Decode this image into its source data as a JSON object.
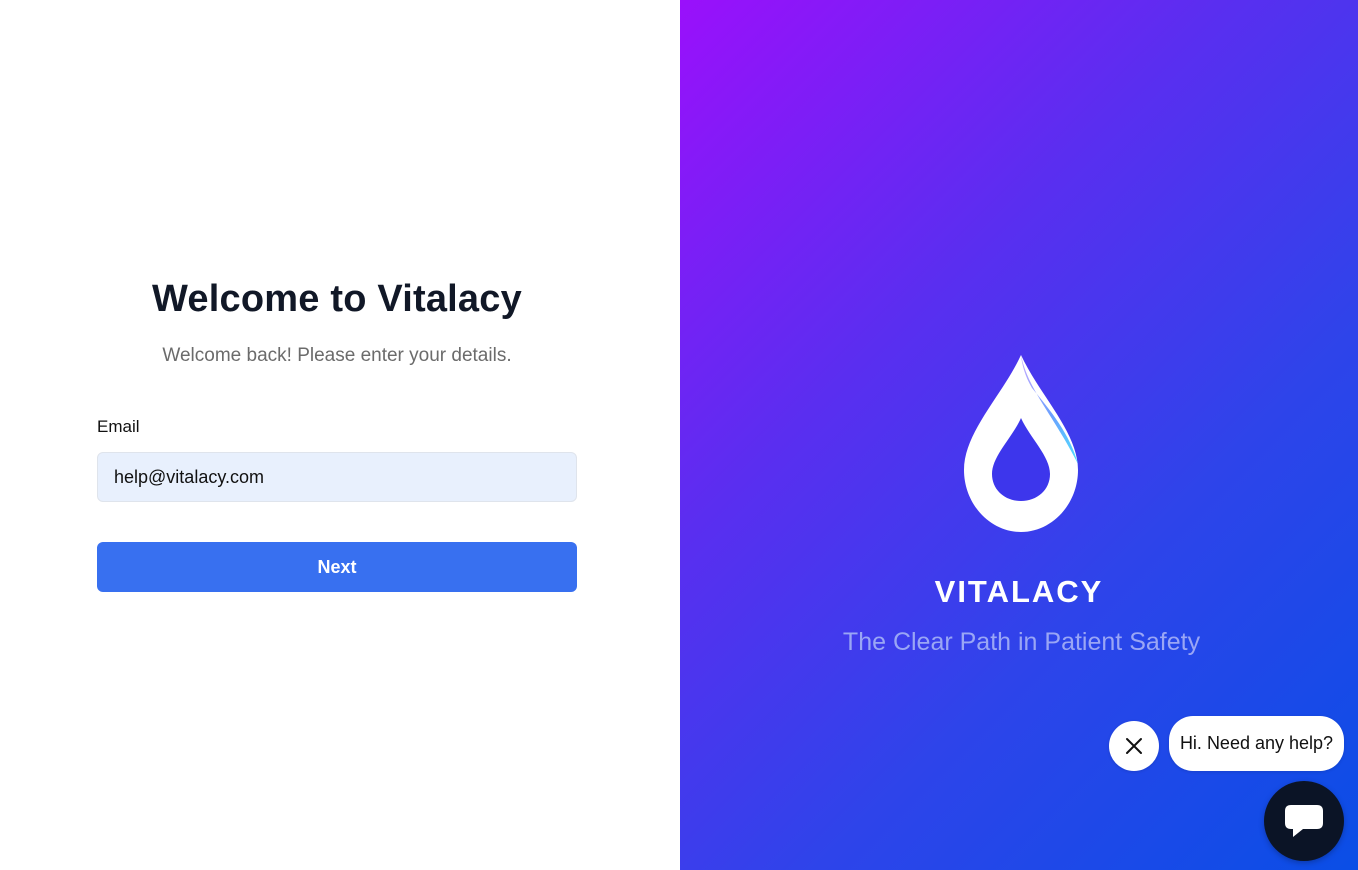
{
  "login": {
    "title": "Welcome to Vitalacy",
    "subtitle": "Welcome back! Please enter your details.",
    "email_label": "Email",
    "email_value": "help@vitalacy.com",
    "next_label": "Next"
  },
  "brand": {
    "logo_icon": "water-drop-icon",
    "name": "VITALACY",
    "tagline": "The Clear Path in Patient Safety"
  },
  "chat": {
    "greeting": "Hi. Need any help?",
    "close_icon": "close-icon",
    "launcher_icon": "chat-icon"
  },
  "colors": {
    "primary_button": "#3870f0",
    "input_background": "#e8f0fd",
    "gradient_start": "#9a10fb",
    "gradient_end": "#0a4ee6",
    "chat_launcher": "#0b1426"
  }
}
